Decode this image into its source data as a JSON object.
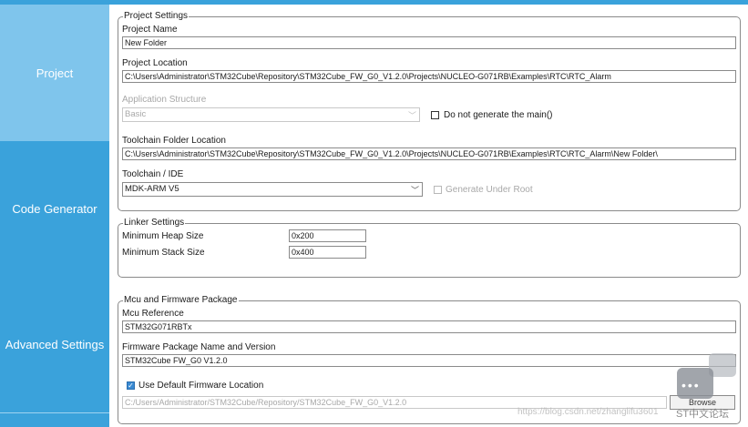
{
  "sidebar": {
    "items": [
      {
        "label": "Project"
      },
      {
        "label": "Code Generator"
      },
      {
        "label": "Advanced Settings"
      }
    ]
  },
  "project_settings": {
    "legend": "Project Settings",
    "name_label": "Project Name",
    "name_value": "New Folder",
    "location_label": "Project Location",
    "location_value": "C:\\Users\\Administrator\\STM32Cube\\Repository\\STM32Cube_FW_G0_V1.2.0\\Projects\\NUCLEO-G071RB\\Examples\\RTC\\RTC_Alarm",
    "app_structure_label": "Application Structure",
    "app_structure_value": "Basic",
    "no_main_label": "Do not generate the main()",
    "toolchain_folder_label": "Toolchain Folder Location",
    "toolchain_folder_value": "C:\\Users\\Administrator\\STM32Cube\\Repository\\STM32Cube_FW_G0_V1.2.0\\Projects\\NUCLEO-G071RB\\Examples\\RTC\\RTC_Alarm\\New Folder\\",
    "toolchain_ide_label": "Toolchain / IDE",
    "toolchain_ide_value": "MDK-ARM V5",
    "generate_under_root_label": "Generate Under Root"
  },
  "linker_settings": {
    "legend": "Linker Settings",
    "heap_label": "Minimum Heap Size",
    "heap_value": "0x200",
    "stack_label": "Minimum Stack Size",
    "stack_value": "0x400"
  },
  "mcu_package": {
    "legend": "Mcu and Firmware Package",
    "mcu_ref_label": "Mcu Reference",
    "mcu_ref_value": "STM32G071RBTx",
    "fw_label": "Firmware Package Name and Version",
    "fw_value": "STM32Cube FW_G0 V1.2.0",
    "use_default_label": "Use Default Firmware Location",
    "fw_location_value": "C:/Users/Administrator/STM32Cube/Repository/STM32Cube_FW_G0_V1.2.0",
    "browse_label": "Browse"
  },
  "watermark": {
    "url": "https://blog.csdn.net/zhanglifu3601",
    "forum": "ST中文论坛"
  }
}
